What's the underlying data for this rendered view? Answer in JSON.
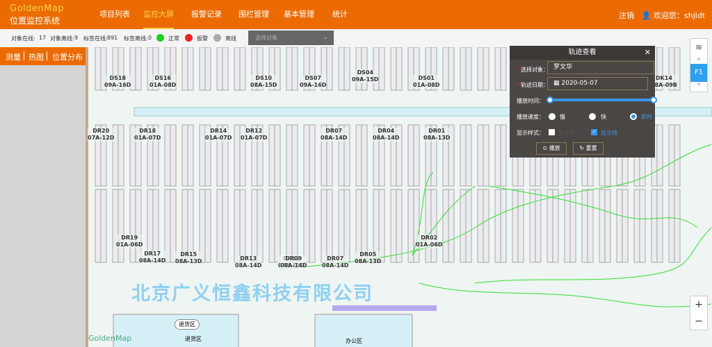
{
  "header": {
    "logo_en": "GoldenMap",
    "logo_cn": "位置监控系统",
    "nav": [
      {
        "label": "项目列表",
        "active": false
      },
      {
        "label": "监控大屏",
        "active": true
      },
      {
        "label": "报警记录",
        "active": false
      },
      {
        "label": "围栏管理",
        "active": false
      },
      {
        "label": "基本管理",
        "active": false
      },
      {
        "label": "统计",
        "active": false
      }
    ],
    "logout": "注销",
    "welcome": "欢迎您：shjldt"
  },
  "status": {
    "obj_online_label": "对象在线:",
    "obj_online": "17",
    "obj_offline_label": "对象离线:",
    "obj_offline": "9",
    "tag_online_label": "标签在线:",
    "tag_online": "891",
    "tag_offline_label": "标签离线:",
    "tag_offline": "0",
    "legend": [
      {
        "label": "正常",
        "color": "#22cc22"
      },
      {
        "label": "报警",
        "color": "#ee2222"
      },
      {
        "label": "离线",
        "color": "#aaaaaa"
      }
    ],
    "select_placeholder": "选择对象"
  },
  "toolbar": {
    "items": [
      "测量",
      "热图",
      "位置分布"
    ]
  },
  "map": {
    "watermark": "北京广义恒鑫科技有限公司",
    "logo": "GoldenMap",
    "zones": [
      {
        "label": "退货区",
        "badge": "退货区"
      },
      {
        "label": "办公区"
      }
    ],
    "shelves_top": [
      {
        "code": "DS18",
        "range": "09A-16D"
      },
      {
        "code": "DS16",
        "range": "01A-08D"
      },
      {
        "code": "DS10",
        "range": "08A-15D"
      },
      {
        "code": "DS07",
        "range": "09A-16D"
      },
      {
        "code": "DS04",
        "range": "09A-15D"
      },
      {
        "code": "DS01",
        "range": "01A-08D"
      },
      {
        "code": "DK14",
        "range": "08A-09B"
      }
    ],
    "shelves_mid": [
      {
        "code": "DR20",
        "range": "07A-12D"
      },
      {
        "code": "DR18",
        "range": "01A-07D"
      },
      {
        "code": "DR14",
        "range": "01A-07D"
      },
      {
        "code": "DR12",
        "range": "01A-07D"
      },
      {
        "code": "DR07",
        "range": "08A-14D"
      },
      {
        "code": "DR04",
        "range": "08A-14D"
      },
      {
        "code": "DR01",
        "range": "08A-13D"
      }
    ],
    "shelves_bottom": [
      {
        "code": "DR19",
        "range": "01A-06D"
      },
      {
        "code": "DR17",
        "range": "08A-14D"
      },
      {
        "code": "DR15",
        "range": "08A-13D"
      },
      {
        "code": "DR13",
        "range": "08A-14D"
      },
      {
        "code": "DR11",
        "range": "07A-13D"
      },
      {
        "code": "DR09",
        "range": "08A-14D"
      },
      {
        "code": "DR07",
        "range": "08A-14D"
      },
      {
        "code": "DR05",
        "range": "08A-13D"
      },
      {
        "code": "DR02",
        "range": "01A-06D"
      }
    ]
  },
  "dialog": {
    "title": "轨迹查看",
    "object_label": "选择对象：",
    "object_value": "罗文华",
    "date_label": "轨迹日期：",
    "date_value": "2020-05-07",
    "time_label": "播放时间：",
    "time_range": [
      0,
      1
    ],
    "speed_label": "播放速度：",
    "speed_options": [
      "慢",
      "快",
      "即时"
    ],
    "speed_selected": "即时",
    "style_label": "显示样式：",
    "style_options": [
      {
        "label": "显示点",
        "checked": false
      },
      {
        "label": "显示线",
        "checked": true
      }
    ],
    "play_button": "播放",
    "reset_button": "重置"
  },
  "floor_control": {
    "current": "F1"
  },
  "zoom_control": {
    "in": "+",
    "out": "−"
  }
}
